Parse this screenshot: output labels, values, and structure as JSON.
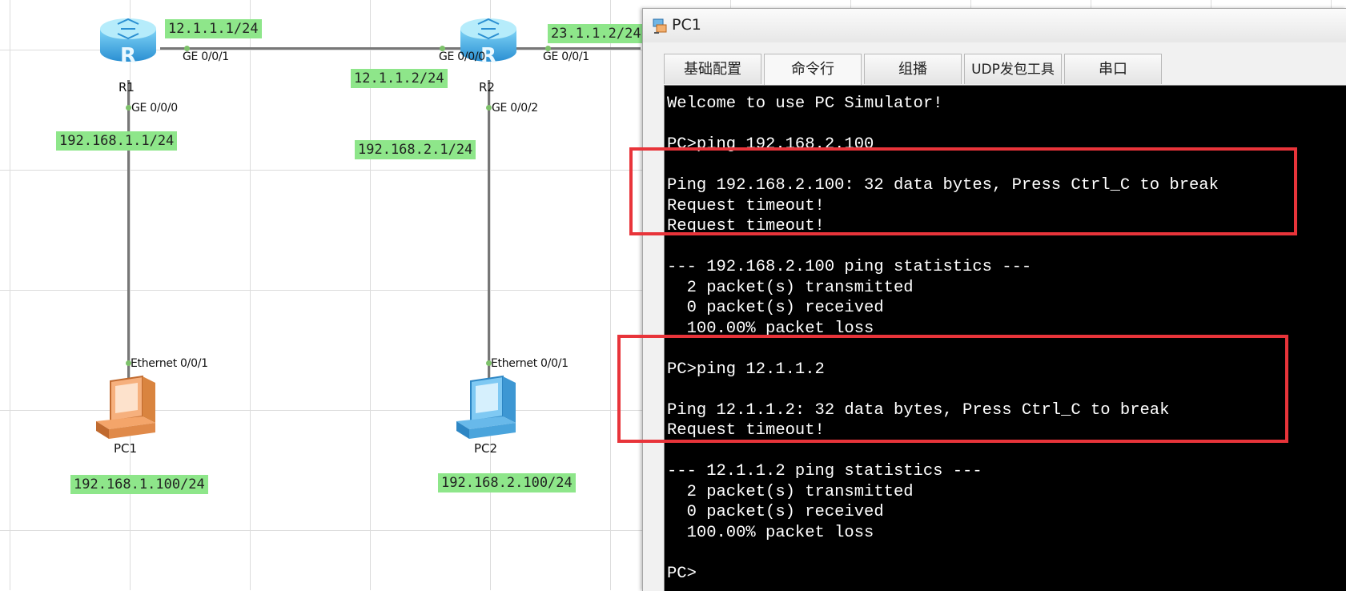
{
  "topology": {
    "devices": {
      "r1": {
        "name": "R1",
        "icon": "router-icon"
      },
      "r2": {
        "name": "R2",
        "icon": "router-icon"
      },
      "pc1": {
        "name": "PC1",
        "icon": "pc-icon"
      },
      "pc2": {
        "name": "PC2",
        "icon": "pc-icon"
      }
    },
    "ports": {
      "r1_ge001": "GE 0/0/1",
      "r1_ge000": "GE 0/0/0",
      "r2_ge000": "GE 0/0/0",
      "r2_ge001": "GE 0/0/1",
      "r2_ge002": "GE 0/0/2",
      "pc1_eth": "Ethernet 0/0/1",
      "pc2_eth": "Ethernet 0/0/1"
    },
    "ip_labels": {
      "r1_ge001": "12.1.1.1/24",
      "r1_ge000": "192.168.1.1/24",
      "r2_ge000": "12.1.1.2/24",
      "r2_ge001": "23.1.1.2/24",
      "r2_ge002": "192.168.2.1/24",
      "pc1": "192.168.1.100/24",
      "pc2": "192.168.2.100/24"
    }
  },
  "simulator": {
    "title": "PC1",
    "tabs": [
      "基础配置",
      "命令行",
      "组播",
      "UDP发包工具",
      "串口"
    ],
    "active_tab": "命令行",
    "console_lines": [
      "Welcome to use PC Simulator!",
      "",
      "PC>ping 192.168.2.100",
      "",
      "Ping 192.168.2.100: 32 data bytes, Press Ctrl_C to break",
      "Request timeout!",
      "Request timeout!",
      "",
      "--- 192.168.2.100 ping statistics ---",
      "  2 packet(s) transmitted",
      "  0 packet(s) received",
      "  100.00% packet loss",
      "",
      "PC>ping 12.1.1.2",
      "",
      "Ping 12.1.1.2: 32 data bytes, Press Ctrl_C to break",
      "Request timeout!",
      "",
      "--- 12.1.1.2 ping statistics ---",
      "  2 packet(s) transmitted",
      "  0 packet(s) received",
      "  100.00% packet loss",
      "",
      "PC>"
    ]
  },
  "colors": {
    "highlight": "#e8343a",
    "ip_label_bg": "#8ee68a",
    "console_bg": "#000000"
  }
}
